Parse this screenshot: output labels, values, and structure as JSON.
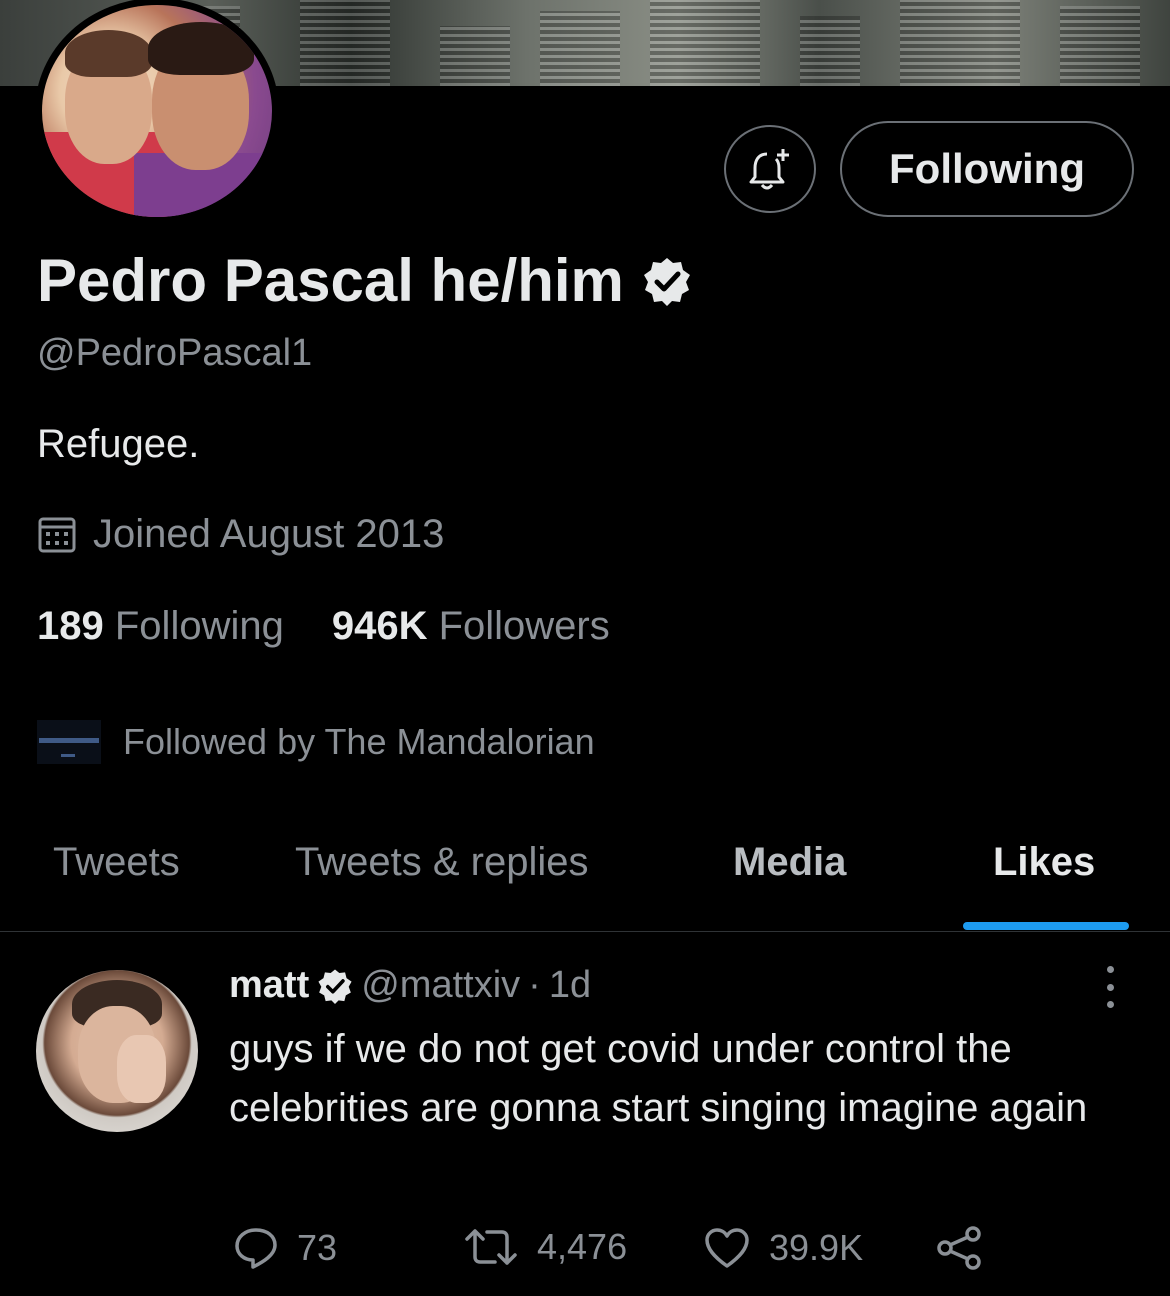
{
  "profile": {
    "name": "Pedro Pascal he/him",
    "handle": "@PedroPascal1",
    "bio": "Refugee.",
    "joined": "Joined August 2013",
    "following_count": "189",
    "following_label": "Following",
    "followers_count": "946K",
    "followers_label": "Followers",
    "followed_by": "Followed by The Mandalorian",
    "follow_button": "Following"
  },
  "tabs": [
    "Tweets",
    "Tweets & replies",
    "Media",
    "Likes"
  ],
  "active_tab": "Likes",
  "tweet": {
    "name": "matt",
    "handle": "@mattxiv",
    "separator": "·",
    "time": "1d",
    "text": "guys if we do not get covid under control the celebrities are gonna start singing imagine again",
    "replies": "73",
    "retweets": "4,476",
    "likes": "39.9K"
  },
  "icons": [
    "bell-plus-icon",
    "verified-badge-icon",
    "calendar-icon",
    "reply-icon",
    "retweet-icon",
    "heart-icon",
    "share-icon",
    "more-icon"
  ],
  "colors": {
    "background": "#000000",
    "accent": "#1d9bf0",
    "secondary_text": "#8b9096"
  }
}
